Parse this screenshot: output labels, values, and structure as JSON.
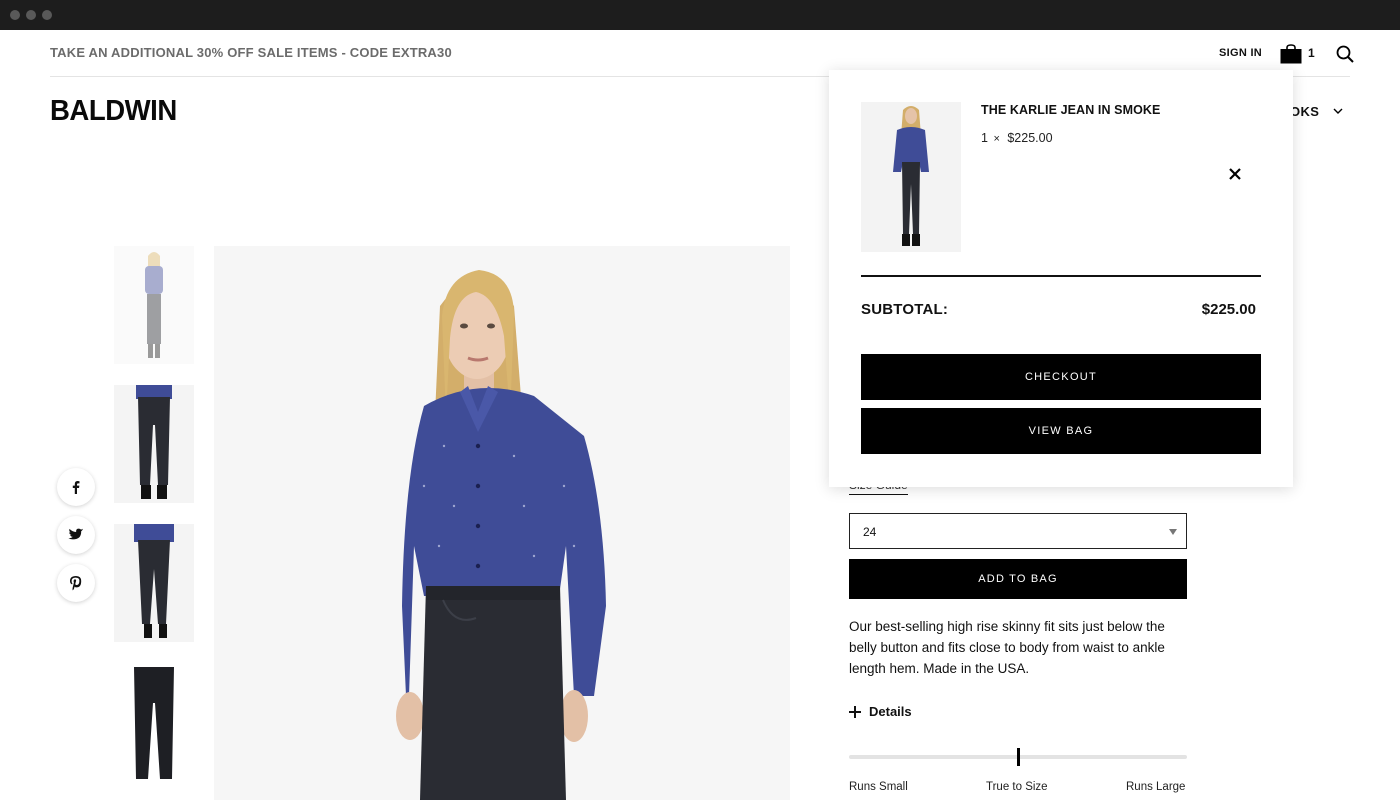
{
  "promo": {
    "text": "TAKE AN ADDITIONAL 30% OFF SALE ITEMS - CODE EXTRA30"
  },
  "utility": {
    "sign_in": "SIGN IN",
    "bag_count": "1"
  },
  "header": {
    "logo": "BALDWIN",
    "nav_partial": "OKS"
  },
  "product": {
    "size_guide": "Size Guide",
    "size_selected": "24",
    "add_to_bag": "ADD TO BAG",
    "description": "Our best-selling high rise skinny fit sits just below the belly button and fits close to body from waist to ankle length hem. Made in the USA.",
    "details_label": "Details",
    "fit": {
      "left": "Runs Small",
      "middle": "True to Size",
      "right": "Runs Large",
      "level": 0.5
    }
  },
  "cart": {
    "item_name": "THE KARLIE JEAN IN SMOKE",
    "quantity": "1",
    "times": "×",
    "price": "$225.00",
    "subtotal_label": "SUBTOTAL:",
    "subtotal_value": "$225.00",
    "checkout": "CHECKOUT",
    "view_bag": "VIEW BAG"
  },
  "icons": {
    "bag": "shopping-bag-icon",
    "search": "search-icon",
    "close": "close-icon",
    "facebook": "facebook-icon",
    "twitter": "twitter-icon",
    "pinterest": "pinterest-icon"
  },
  "colors": {
    "accent": "#000000",
    "promo_text": "#6b6b6b",
    "shirt": "#3f4c97",
    "jeans": "#2a2c33"
  }
}
